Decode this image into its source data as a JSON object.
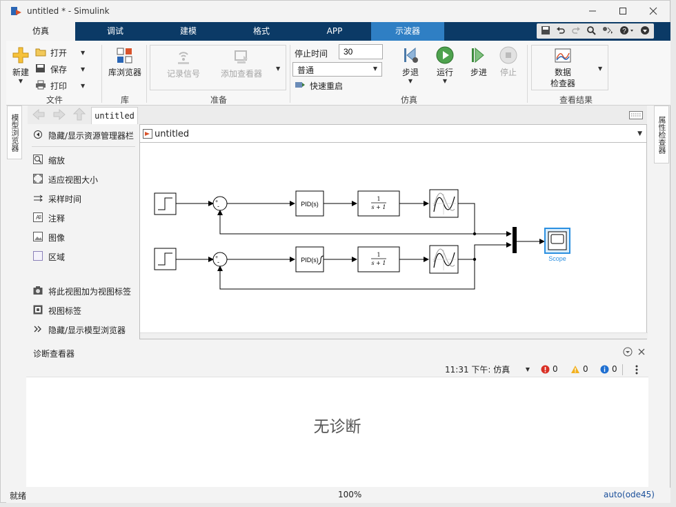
{
  "window": {
    "title": "untitled * - Simulink"
  },
  "tabs": [
    {
      "label": "仿真"
    },
    {
      "label": "调试"
    },
    {
      "label": "建模"
    },
    {
      "label": "格式"
    },
    {
      "label": "APP"
    },
    {
      "label": "示波器"
    }
  ],
  "ribbon": {
    "file": {
      "new_label": "新建",
      "open_label": "打开",
      "save_label": "保存",
      "print_label": "打印",
      "group_label": "文件"
    },
    "library": {
      "browser_label": "库浏览器",
      "group_label": "库"
    },
    "prepare": {
      "log_signals_label": "记录信号",
      "add_viewer_label": "添加查看器",
      "group_label": "准备"
    },
    "simulate": {
      "stop_time_label": "停止时间",
      "stop_time_value": "30",
      "mode_value": "普通",
      "fast_restart_label": "快速重启",
      "step_back_label": "步退",
      "run_label": "运行",
      "step_forward_label": "步进",
      "stop_label": "停止",
      "group_label": "仿真"
    },
    "review": {
      "data_inspector_label_1": "数据",
      "data_inspector_label_2": "检查器",
      "group_label": "查看结果"
    }
  },
  "side_tabs": {
    "left": "模型浏览器",
    "right": "属性检查器"
  },
  "explorer": {
    "tab_label": "untitled",
    "address": "untitled"
  },
  "palette": {
    "items": [
      {
        "label": "隐藏/显示资源管理器栏"
      },
      {
        "label": "缩放"
      },
      {
        "label": "适应视图大小"
      },
      {
        "label": "采样时间"
      },
      {
        "label": "注释"
      },
      {
        "label": "图像"
      },
      {
        "label": "区域"
      },
      {
        "label": "将此视图加为视图标签"
      },
      {
        "label": "视图标签"
      },
      {
        "label": "隐藏/显示模型浏览器"
      }
    ]
  },
  "diagram": {
    "pid1": "PID(s)",
    "pid2": "PID(s)",
    "tf_num": "1",
    "tf_den": "s + 1",
    "scope_label": "Scope",
    "sum_plus": "+",
    "sum_minus": "-"
  },
  "diagnostics": {
    "title": "诊断查看器",
    "timestamp": "11:31 下午: 仿真",
    "errors": "0",
    "warnings": "0",
    "infos": "0",
    "empty_message": "无诊断"
  },
  "status": {
    "left": "就绪",
    "zoom": "100%",
    "solver": "auto(ode45)"
  },
  "colors": {
    "tab_bar": "#0b3a66",
    "context_tab": "#2f7fc4",
    "scope_highlight": "#2a8fe0",
    "solver_link": "#1a4f9a"
  }
}
